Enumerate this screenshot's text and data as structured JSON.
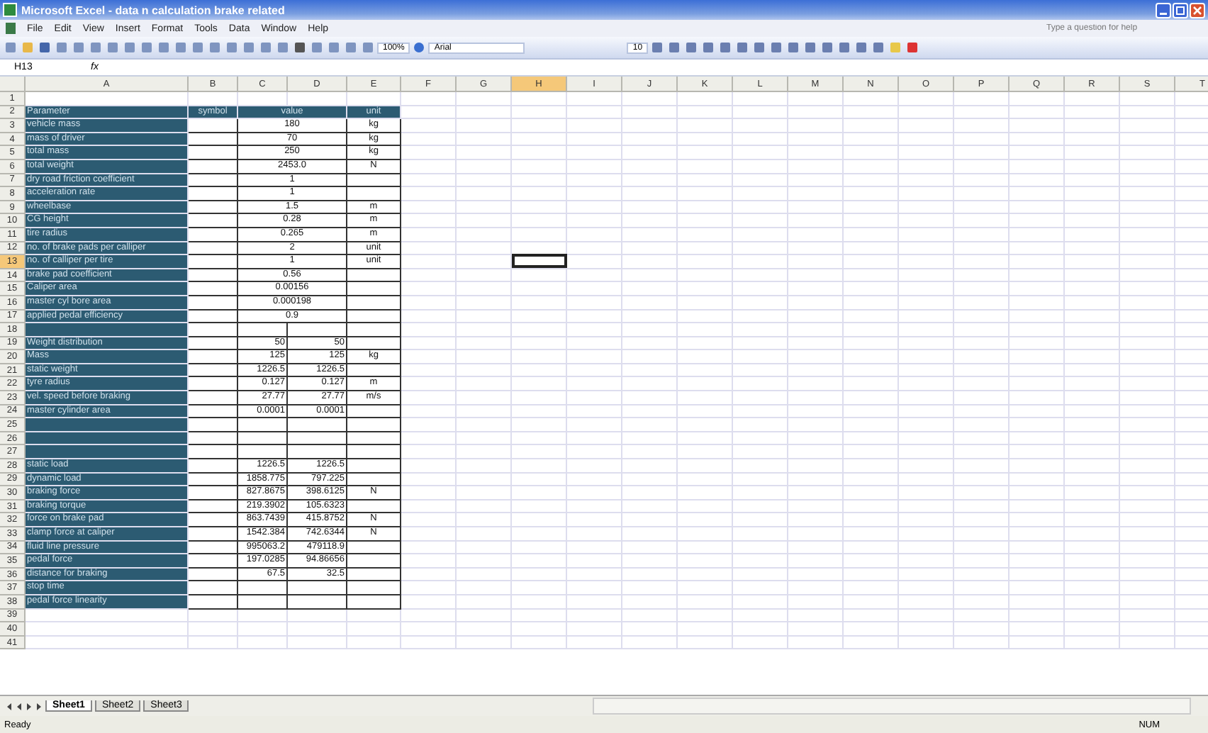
{
  "window": {
    "title": "Microsoft Excel - data n calculation brake related"
  },
  "menu": [
    "File",
    "Edit",
    "View",
    "Insert",
    "Format",
    "Tools",
    "Data",
    "Window",
    "Help"
  ],
  "help_box": {
    "placeholder": "Type a question for help"
  },
  "toolbar": {
    "zoom": "100%",
    "font": "Arial",
    "font_size": "10"
  },
  "formula_bar": {
    "name_box": "H13",
    "fx": "fx"
  },
  "columns": [
    {
      "label": "A",
      "selected": false
    },
    {
      "label": "B",
      "selected": false
    },
    {
      "label": "C",
      "selected": false
    },
    {
      "label": "D",
      "selected": false
    },
    {
      "label": "E",
      "selected": false
    },
    {
      "label": "F",
      "selected": false
    },
    {
      "label": "G",
      "selected": false
    },
    {
      "label": "H",
      "selected": true
    },
    {
      "label": "I",
      "selected": false
    },
    {
      "label": "J",
      "selected": false
    },
    {
      "label": "K",
      "selected": false
    },
    {
      "label": "L",
      "selected": false
    },
    {
      "label": "M",
      "selected": false
    },
    {
      "label": "N",
      "selected": false
    },
    {
      "label": "O",
      "selected": false
    },
    {
      "label": "P",
      "selected": false
    },
    {
      "label": "Q",
      "selected": false
    },
    {
      "label": "R",
      "selected": false
    },
    {
      "label": "S",
      "selected": false
    },
    {
      "label": "T",
      "selected": false
    }
  ],
  "rows": [
    {
      "number": "1",
      "kind": "blank",
      "selected": false
    },
    {
      "number": "2",
      "kind": "header",
      "selected": false,
      "label": "Parameter",
      "symbol": "symbol",
      "value": "value",
      "unit": "unit"
    },
    {
      "number": "3",
      "kind": "merged",
      "selected": false,
      "label": "vehicle mass",
      "value": "180",
      "unit": "kg"
    },
    {
      "number": "4",
      "kind": "merged",
      "selected": false,
      "label": "mass of driver",
      "value": "70",
      "unit": "kg"
    },
    {
      "number": "5",
      "kind": "merged",
      "selected": false,
      "label": "total mass",
      "value": "250",
      "unit": "kg"
    },
    {
      "number": "6",
      "kind": "merged",
      "selected": false,
      "label": "total weight",
      "value": "2453.0",
      "unit": "N"
    },
    {
      "number": "7",
      "kind": "merged",
      "selected": false,
      "label": "dry road friction coefficient",
      "value": "1"
    },
    {
      "number": "8",
      "kind": "merged",
      "selected": false,
      "label": "acceleration rate",
      "value": "1"
    },
    {
      "number": "9",
      "kind": "merged",
      "selected": false,
      "label": "wheelbase",
      "value": "1.5",
      "unit": "m"
    },
    {
      "number": "10",
      "kind": "merged",
      "selected": false,
      "label": "CG height",
      "value": "0.28",
      "unit": "m"
    },
    {
      "number": "11",
      "kind": "merged",
      "selected": false,
      "label": "tire radius",
      "value": "0.265",
      "unit": "m"
    },
    {
      "number": "12",
      "kind": "merged",
      "selected": false,
      "label": "no. of brake pads per calliper",
      "value": "2",
      "unit": "unit"
    },
    {
      "number": "13",
      "kind": "merged",
      "selected": true,
      "label": "no. of calliper per tire",
      "value": "1",
      "unit": "unit"
    },
    {
      "number": "14",
      "kind": "merged",
      "selected": false,
      "label": "brake pad coefficient",
      "value": "0.56"
    },
    {
      "number": "15",
      "kind": "merged",
      "selected": false,
      "label": "Caliper area",
      "value": "0.00156"
    },
    {
      "number": "16",
      "kind": "merged",
      "selected": false,
      "label": "master cyl bore area",
      "value": "0.000198"
    },
    {
      "number": "17",
      "kind": "merged",
      "selected": false,
      "label": "applied pedal efficiency",
      "value": "0.9"
    },
    {
      "number": "18",
      "kind": "split",
      "selected": false
    },
    {
      "number": "19",
      "kind": "split",
      "selected": false,
      "label": "Weight distribution",
      "c": "50",
      "d": "50"
    },
    {
      "number": "20",
      "kind": "split",
      "selected": false,
      "label": "Mass",
      "c": "125",
      "d": "125",
      "unit": "kg"
    },
    {
      "number": "21",
      "kind": "split",
      "selected": false,
      "label": "static weight",
      "c": "1226.5",
      "d": "1226.5"
    },
    {
      "number": "22",
      "kind": "split",
      "selected": false,
      "label": "tyre radius",
      "c": "0.127",
      "d": "0.127",
      "unit": "m"
    },
    {
      "number": "23",
      "kind": "split",
      "selected": false,
      "label": "vel. speed before braking",
      "c": "27.77",
      "d": "27.77",
      "unit": "m/s"
    },
    {
      "number": "24",
      "kind": "split",
      "selected": false,
      "label": "master cylinder area",
      "c": "0.0001",
      "d": "0.0001"
    },
    {
      "number": "25",
      "kind": "split",
      "selected": false
    },
    {
      "number": "26",
      "kind": "split",
      "selected": false
    },
    {
      "number": "27",
      "kind": "split",
      "selected": false
    },
    {
      "number": "28",
      "kind": "split",
      "selected": false,
      "label": "static load",
      "c": "1226.5",
      "d": "1226.5"
    },
    {
      "number": "29",
      "kind": "split",
      "selected": false,
      "label": "dynamic load",
      "c": "1858.775",
      "d": "797.225"
    },
    {
      "number": "30",
      "kind": "split",
      "selected": false,
      "label": "braking force",
      "c": "827.8675",
      "d": "398.6125",
      "unit": "N"
    },
    {
      "number": "31",
      "kind": "split",
      "selected": false,
      "label": "braking torque",
      "c": "219.3902",
      "d": "105.6323"
    },
    {
      "number": "32",
      "kind": "split",
      "selected": false,
      "label": "force on brake pad",
      "c": "863.7439",
      "d": "415.8752",
      "unit": "N"
    },
    {
      "number": "33",
      "kind": "split",
      "selected": false,
      "label": "clamp force at caliper",
      "c": "1542.384",
      "d": "742.6344",
      "unit": "N"
    },
    {
      "number": "34",
      "kind": "split",
      "selected": false,
      "label": "fluid line pressure",
      "c": "995063.2",
      "d": "479118.9"
    },
    {
      "number": "35",
      "kind": "split",
      "selected": false,
      "label": "pedal force",
      "c": "197.0285",
      "d": "94.86656"
    },
    {
      "number": "36",
      "kind": "split",
      "selected": false,
      "label": "distance for braking",
      "c": "67.5",
      "d": "32.5"
    },
    {
      "number": "37",
      "kind": "split",
      "selected": false,
      "label": "stop time"
    },
    {
      "number": "38",
      "kind": "split",
      "selected": false,
      "label": "pedal force linearity"
    },
    {
      "number": "39",
      "kind": "blank",
      "selected": false
    },
    {
      "number": "40",
      "kind": "blank",
      "selected": false
    },
    {
      "number": "41",
      "kind": "blank",
      "selected": false
    }
  ],
  "sheet_tabs": [
    {
      "label": "Sheet1",
      "selected": true
    },
    {
      "label": "Sheet2",
      "selected": false
    },
    {
      "label": "Sheet3",
      "selected": false
    }
  ],
  "status_bar": {
    "left": "Ready",
    "right": "NUM"
  }
}
